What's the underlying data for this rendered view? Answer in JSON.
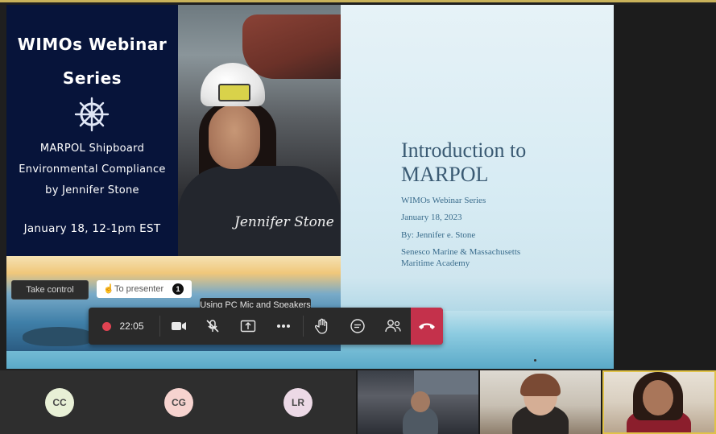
{
  "webinar_poster": {
    "title_line1": "WIMOs Webinar",
    "title_line2": "Series",
    "subtitle_line1": "MARPOL Shipboard",
    "subtitle_line2": "Environmental Compliance",
    "subtitle_line3": "by Jennifer Stone",
    "date": "January 18, 12-1pm EST",
    "signature": "Jennifer Stone"
  },
  "share_controls": {
    "take_control": "Take control",
    "to_presenter": "To presenter",
    "presenter_count": "1",
    "tooltip": "Using PC Mic and Speakers"
  },
  "toolbar": {
    "recording_time": "22:05"
  },
  "slide": {
    "title_line1": "Introduction to",
    "title_line2": "MARPOL",
    "series": "WIMOs Webinar Series",
    "date": "January 18, 2023",
    "author": "By: Jennifer e. Stone",
    "affiliation_line1": "Senesco Marine & Massachusetts",
    "affiliation_line2": "Maritime Academy"
  },
  "participants": [
    {
      "initials": "CC",
      "color": "#e8f0d6"
    },
    {
      "initials": "CG",
      "color": "#f6d3cf"
    },
    {
      "initials": "LR",
      "color": "#ecd9e6"
    }
  ],
  "icons": {
    "record": "record-dot-icon",
    "camera": "camera-icon",
    "mic": "mic-off-icon",
    "share": "share-screen-icon",
    "more": "more-icon",
    "hand": "raise-hand-icon",
    "chat": "chat-icon",
    "people": "people-icon",
    "hangup": "hang-up-icon",
    "wheel": "ship-wheel-icon"
  }
}
